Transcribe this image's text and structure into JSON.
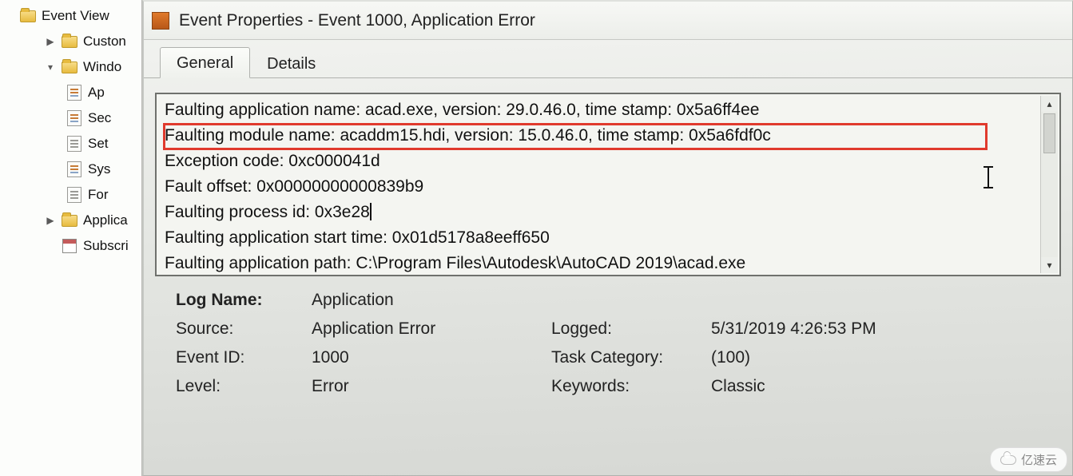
{
  "tree": {
    "root": "Event View",
    "custom": "Custon",
    "windows": "Windo",
    "app": "Ap",
    "sec": "Sec",
    "set": "Set",
    "sys": "Sys",
    "for": "For",
    "applica": "Applica",
    "subscri": "Subscri"
  },
  "dialog": {
    "title": "Event Properties - Event 1000, Application Error",
    "tabs": {
      "general": "General",
      "details": "Details"
    },
    "lines": {
      "l1": "Faulting application name: acad.exe, version: 29.0.46.0, time stamp: 0x5a6ff4ee",
      "l2": "Faulting module name: acaddm15.hdi, version: 15.0.46.0, time stamp: 0x5a6fdf0c",
      "l3": "Exception code: 0xc000041d",
      "l4": "Fault offset: 0x00000000000839b9",
      "l5": "Faulting process id: 0x3e28",
      "l6": "Faulting application start time: 0x01d5178a8eeff650",
      "l7": "Faulting application path: C:\\Program Files\\Autodesk\\AutoCAD 2019\\acad.exe"
    },
    "props": {
      "logname_label": "Log Name:",
      "logname": "Application",
      "source_label": "Source:",
      "source": "Application Error",
      "eventid_label": "Event ID:",
      "eventid": "1000",
      "level_label": "Level:",
      "level": "Error",
      "logged_label": "Logged:",
      "logged": "5/31/2019 4:26:53 PM",
      "taskcat_label": "Task Category:",
      "taskcat": "(100)",
      "keywords_label": "Keywords:",
      "keywords": "Classic"
    }
  },
  "watermark": "亿速云"
}
